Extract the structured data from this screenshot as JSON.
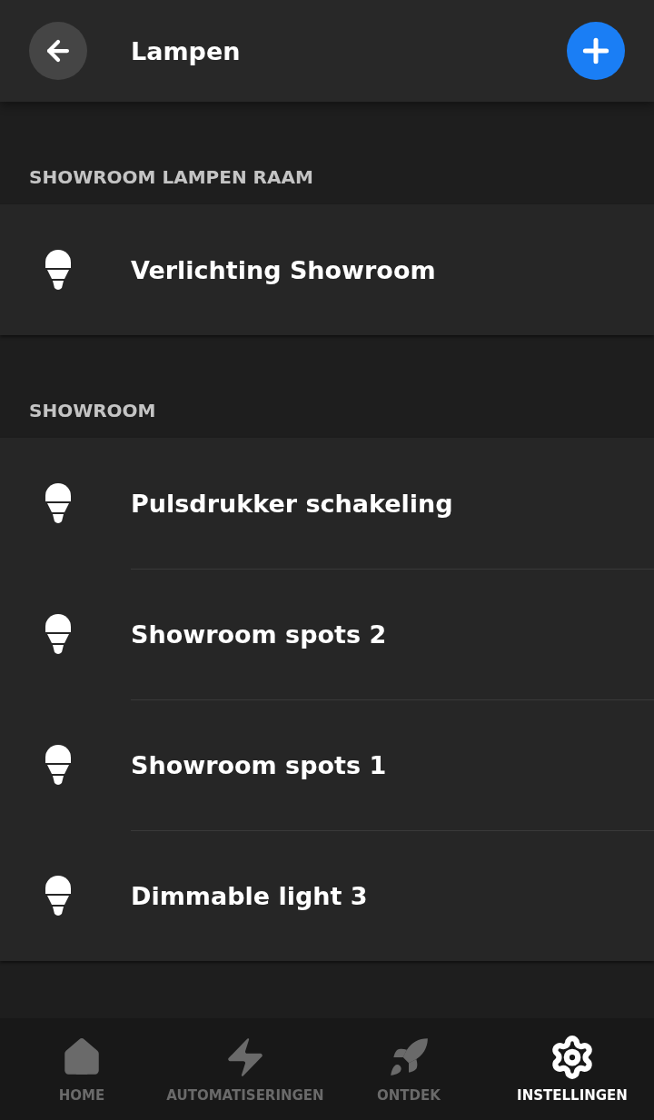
{
  "header": {
    "title": "Lampen"
  },
  "sections": [
    {
      "title": "SHOWROOM LAMPEN RAAM",
      "items": [
        {
          "label": "Verlichting Showroom"
        }
      ]
    },
    {
      "title": "SHOWROOM",
      "items": [
        {
          "label": "Pulsdrukker schakeling"
        },
        {
          "label": "Showroom spots 2"
        },
        {
          "label": "Showroom spots 1"
        },
        {
          "label": "Dimmable light 3"
        }
      ]
    }
  ],
  "nav": [
    {
      "kind": "home",
      "label": "HOME",
      "selected": false
    },
    {
      "kind": "automation",
      "label": "AUTOMATISERINGEN",
      "selected": false
    },
    {
      "kind": "explore",
      "label": "ONTDEK",
      "selected": false
    },
    {
      "kind": "settings",
      "label": "INSTELLINGEN",
      "selected": true
    }
  ]
}
